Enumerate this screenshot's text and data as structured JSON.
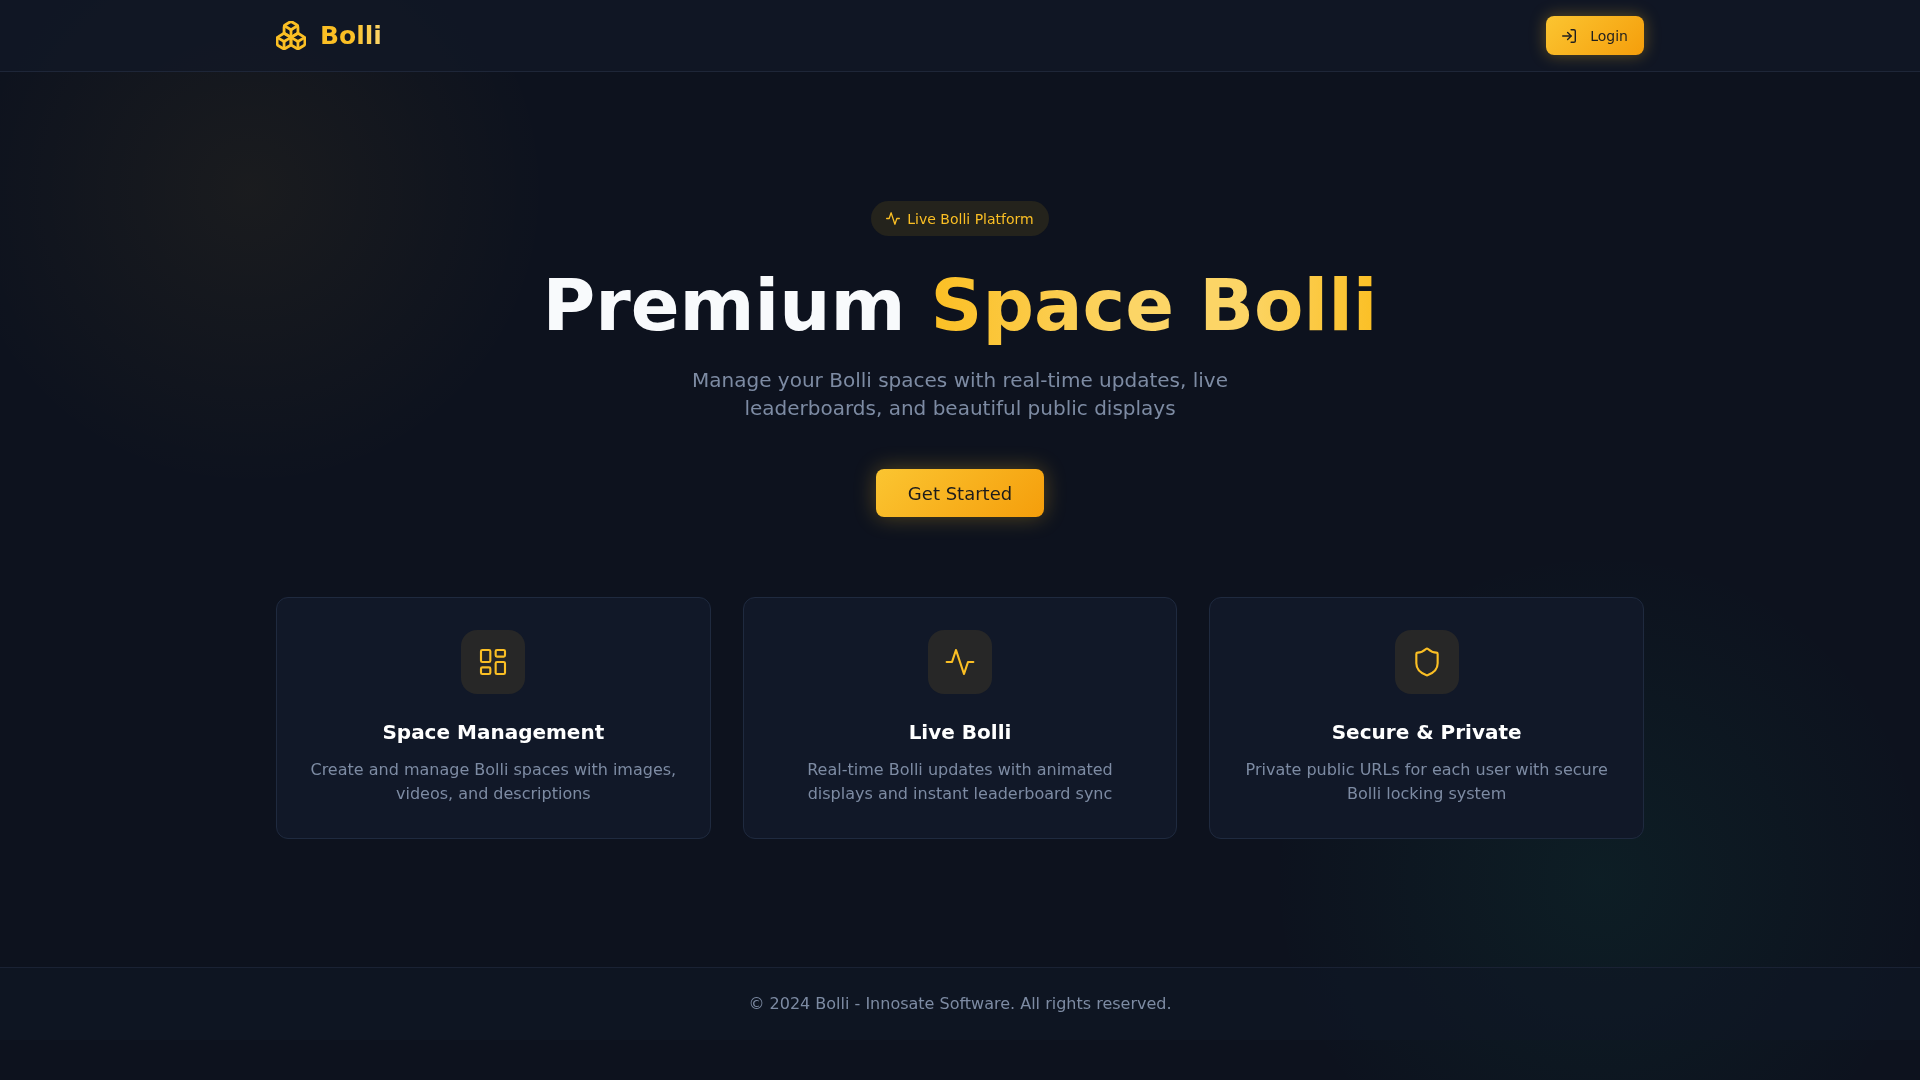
{
  "header": {
    "brand": "Bolli",
    "login_button": "Login"
  },
  "hero": {
    "badge": "Live Bolli Platform",
    "title": [
      {
        "text": "Premium",
        "highlight": false
      },
      {
        "text": "Space Bolli",
        "highlight": true
      }
    ],
    "subtitle": "Manage your Bolli spaces with real-time updates, live leaderboards, and beautiful public displays",
    "cta_button": "Get Started"
  },
  "features": [
    {
      "title": "Space Management",
      "description": "Create and manage Bolli spaces with images, videos, and descriptions"
    },
    {
      "title": "Live Bolli",
      "description": "Real-time Bolli updates with animated displays and instant leaderboard sync"
    },
    {
      "title": "Secure & Private",
      "description": "Private public URLs for each user with secure Bolli locking system"
    }
  ],
  "footer": {
    "copyright": "© 2024 Bolli - Innosate Software. All rights reserved."
  }
}
